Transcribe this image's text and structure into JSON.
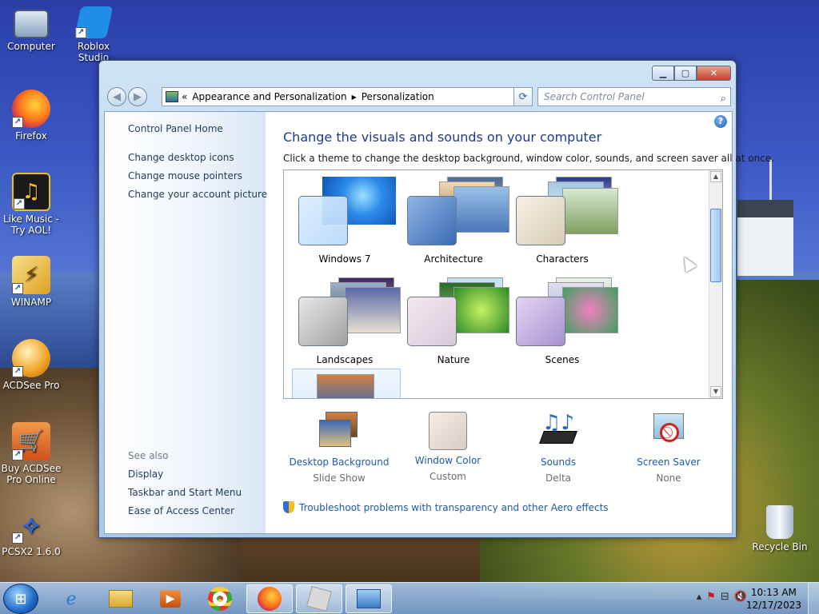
{
  "desktop": {
    "icons": [
      {
        "label": "Computer"
      },
      {
        "label": "Roblox Studio"
      },
      {
        "label": "Firefox"
      },
      {
        "label": "Like Music - Try AOL!"
      },
      {
        "label": "WINAMP"
      },
      {
        "label": "ACDSee Pro"
      },
      {
        "label": "Buy ACDSee Pro Online"
      },
      {
        "label": "PCSX2 1.6.0"
      },
      {
        "label": "Recycle Bin"
      }
    ]
  },
  "window": {
    "address": {
      "chevrons": "«",
      "crumbs": [
        "Appearance and Personalization",
        "Personalization"
      ],
      "separator": "▶"
    },
    "search_placeholder": "Search Control Panel",
    "left_pane": {
      "home": "Control Panel Home",
      "links": [
        "Change desktop icons",
        "Change mouse pointers",
        "Change your account picture"
      ],
      "see_also_title": "See also",
      "see_also": [
        "Display",
        "Taskbar and Start Menu",
        "Ease of Access Center"
      ]
    },
    "heading": "Change the visuals and sounds on your computer",
    "subtext": "Click a theme to change the desktop background, window color, sounds, and screen saver all at once.",
    "themes": [
      {
        "name": "Windows 7"
      },
      {
        "name": "Architecture"
      },
      {
        "name": "Characters"
      },
      {
        "name": "Landscapes"
      },
      {
        "name": "Nature"
      },
      {
        "name": "Scenes"
      }
    ],
    "bottom_items": [
      {
        "title": "Desktop Background",
        "sub": "Slide Show",
        "icon": "desktop-background-icon"
      },
      {
        "title": "Window Color",
        "sub": "Custom",
        "icon": "window-color-icon"
      },
      {
        "title": "Sounds",
        "sub": "Delta",
        "icon": "sounds-icon"
      },
      {
        "title": "Screen Saver",
        "sub": "None",
        "icon": "screen-saver-icon"
      }
    ],
    "troubleshoot": "Troubleshoot problems with transparency and other Aero effects"
  },
  "taskbar": {
    "clock_time": "10:13 AM",
    "clock_date": "12/17/2023"
  },
  "colors": {
    "link_blue": "#1e5aa8",
    "heading_blue": "#1e3a8a"
  }
}
